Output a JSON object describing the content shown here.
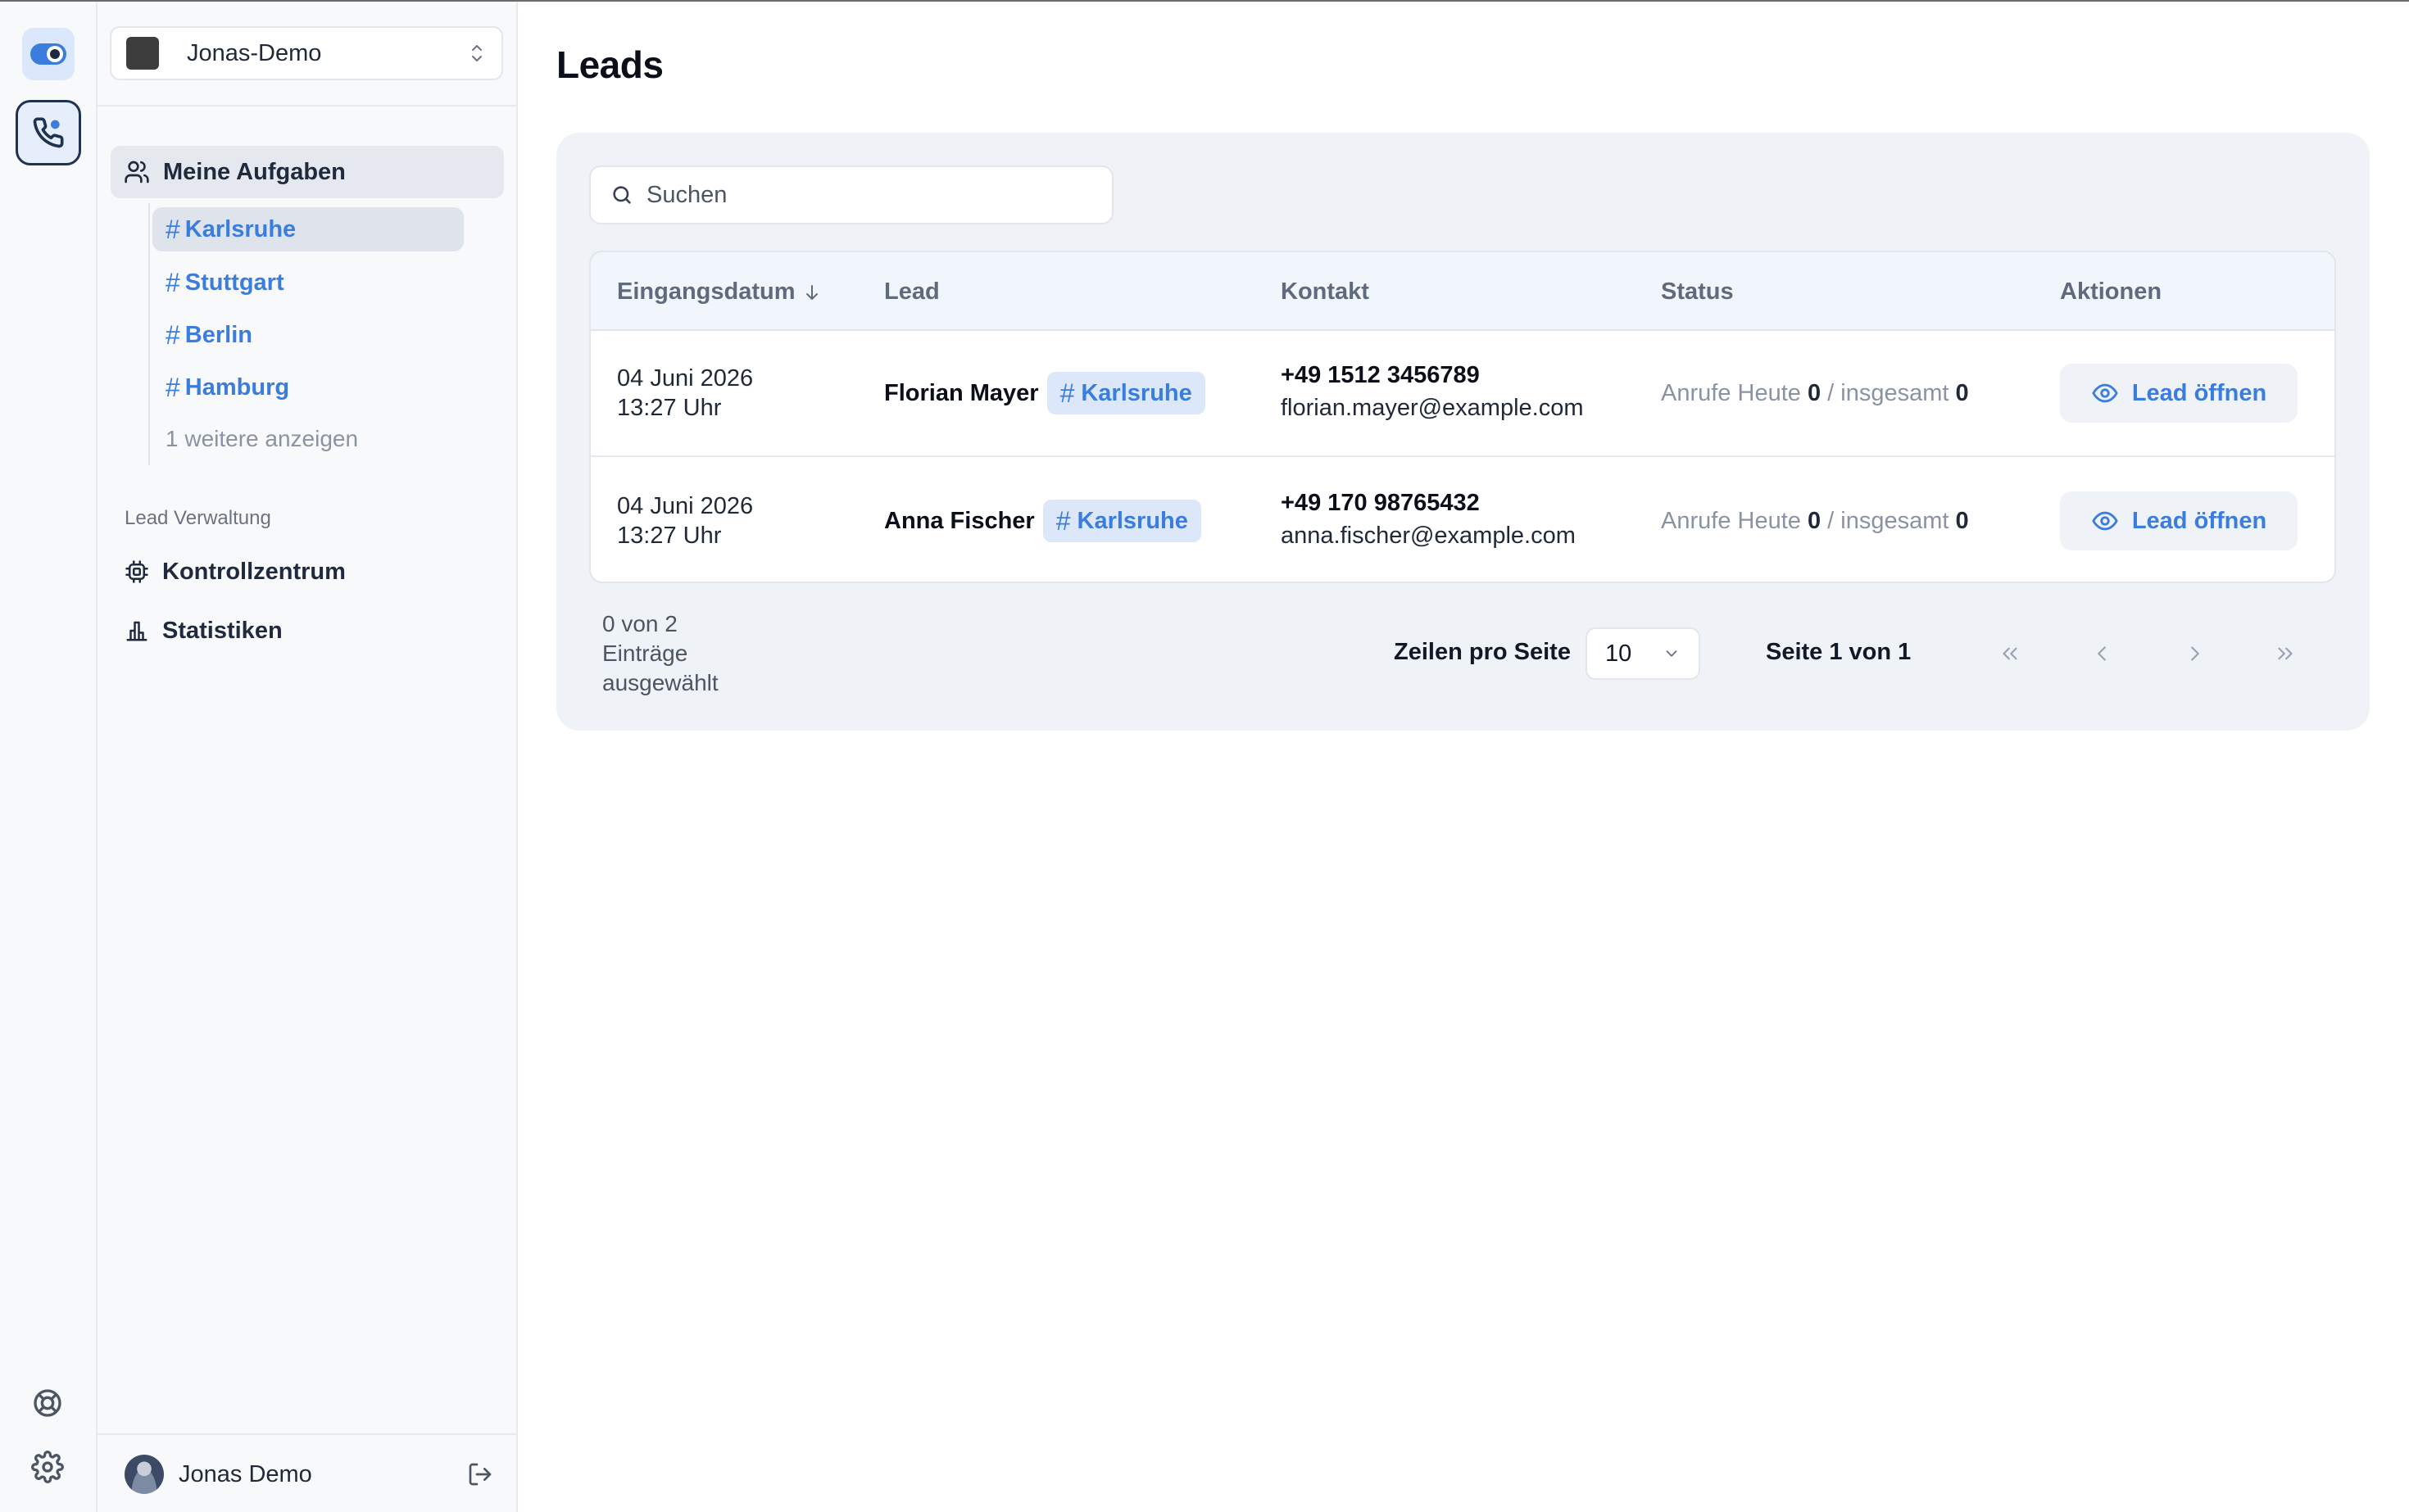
{
  "rail": {
    "logo_icon": "toggle-logo-icon",
    "app_icon": "phone-icon",
    "help_icon": "lifebuoy-icon",
    "settings_icon": "gear-icon"
  },
  "sidebar": {
    "workspace": "Jonas-Demo",
    "main_nav": "Meine Aufgaben",
    "channels": [
      {
        "hash": "#",
        "label": "Karlsruhe"
      },
      {
        "hash": "#",
        "label": "Stuttgart"
      },
      {
        "hash": "#",
        "label": "Berlin"
      },
      {
        "hash": "#",
        "label": "Hamburg"
      }
    ],
    "more": "1 weitere anzeigen",
    "section_label": "Lead Verwaltung",
    "items": [
      {
        "label": "Kontrollzentrum",
        "icon": "cpu-icon"
      },
      {
        "label": "Statistiken",
        "icon": "bar-chart-icon"
      }
    ],
    "user_name": "Jonas Demo"
  },
  "main": {
    "title": "Leads",
    "search_placeholder": "Suchen",
    "columns": {
      "date": "Eingangsdatum",
      "lead": "Lead",
      "contact": "Kontakt",
      "status": "Status",
      "actions": "Aktionen"
    },
    "rows": [
      {
        "date": "04 Juni 2026",
        "time": "13:27 Uhr",
        "name": "Florian Mayer",
        "tag_hash": "#",
        "tag": "Karlsruhe",
        "phone": "+49 1512 3456789",
        "email": "florian.mayer@example.com",
        "status_today_label": "Anrufe Heute",
        "status_today": "0",
        "status_sep": "/",
        "status_total_label": "insgesamt",
        "status_total": "0",
        "action": "Lead öffnen"
      },
      {
        "date": "04 Juni 2026",
        "time": "13:27 Uhr",
        "name": "Anna Fischer",
        "tag_hash": "#",
        "tag": "Karlsruhe",
        "phone": "+49 170 98765432",
        "email": "anna.fischer@example.com",
        "status_today_label": "Anrufe Heute",
        "status_today": "0",
        "status_sep": "/",
        "status_total_label": "insgesamt",
        "status_total": "0",
        "action": "Lead öffnen"
      }
    ],
    "footer": {
      "selection_line1": "0 von 2",
      "selection_line2": "Einträge",
      "selection_line3": "ausgewählt",
      "rows_per_page_label": "Zeilen pro Seite",
      "rows_per_page_value": "10",
      "page_info": "Seite 1 von 1"
    }
  },
  "colors": {
    "accent": "#3b7ddd",
    "card_bg": "#eff3f8",
    "header_bg": "#f1f6fc",
    "tag_bg": "#dce8f9"
  }
}
